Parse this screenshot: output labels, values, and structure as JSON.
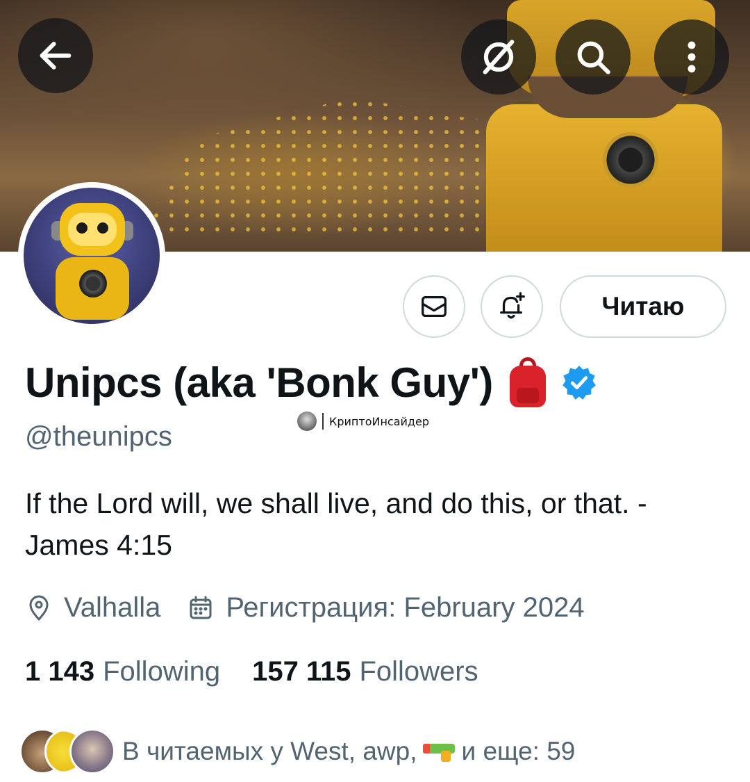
{
  "header": {
    "back_icon": "arrow-left-icon",
    "grok_icon": "grok-icon",
    "search_icon": "search-icon",
    "more_icon": "more-vertical-icon"
  },
  "profile": {
    "name": "Unipcs (aka 'Bonk Guy')",
    "name_emoji": "backpack-emoji",
    "verified": "verified-badge-icon",
    "handle": "@theunipcs",
    "bio": "If the Lord will, we shall live, and do this, or that. - James 4:15",
    "location": "Valhalla",
    "joined": "Регистрация: February 2024"
  },
  "actions": {
    "message_icon": "envelope-icon",
    "notify_icon": "bell-plus-icon",
    "follow_label": "Читаю"
  },
  "stats": {
    "following_count": "1 143",
    "following_label": "Following",
    "followers_count": "157 115",
    "followers_label": "Followers"
  },
  "followed_by": {
    "prefix": "В читаемых у West, awp,",
    "suffix": "и еще: 59"
  },
  "watermark": {
    "text": "КриптоИнсайдер"
  },
  "colors": {
    "text_primary": "#0f1419",
    "text_secondary": "#536471",
    "border": "#cfd9de",
    "verified_blue": "#1d9bf0"
  }
}
